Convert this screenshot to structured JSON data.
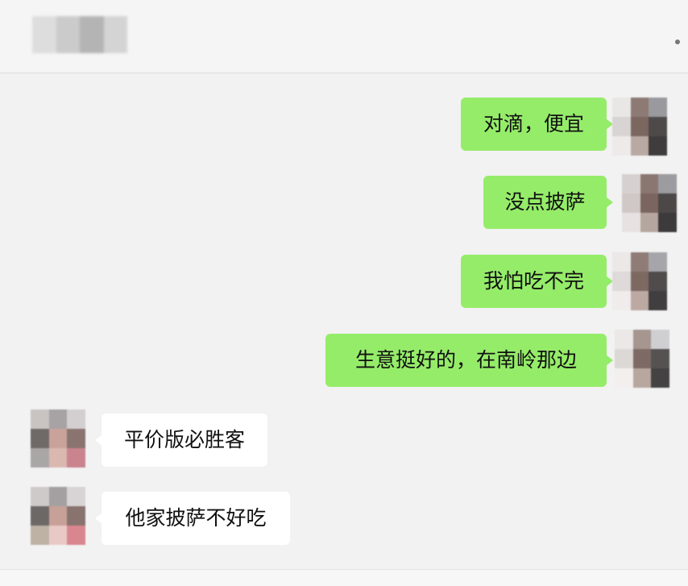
{
  "messages": [
    {
      "direction": "outgoing",
      "text": "对滴，便宜"
    },
    {
      "direction": "outgoing",
      "text": "没点披萨"
    },
    {
      "direction": "outgoing",
      "text": "我怕吃不完"
    },
    {
      "direction": "outgoing",
      "text": "生意挺好的，在南岭那边"
    },
    {
      "direction": "incoming",
      "text": "平价版必胜客"
    },
    {
      "direction": "incoming",
      "text": "他家披萨不好吃"
    }
  ],
  "icons": {
    "more": "more-dot-icon",
    "avatar": "blurred-avatar"
  },
  "colors": {
    "background": "#f2f2f2",
    "outgoing_bubble": "#95ec69",
    "incoming_bubble": "#ffffff"
  }
}
